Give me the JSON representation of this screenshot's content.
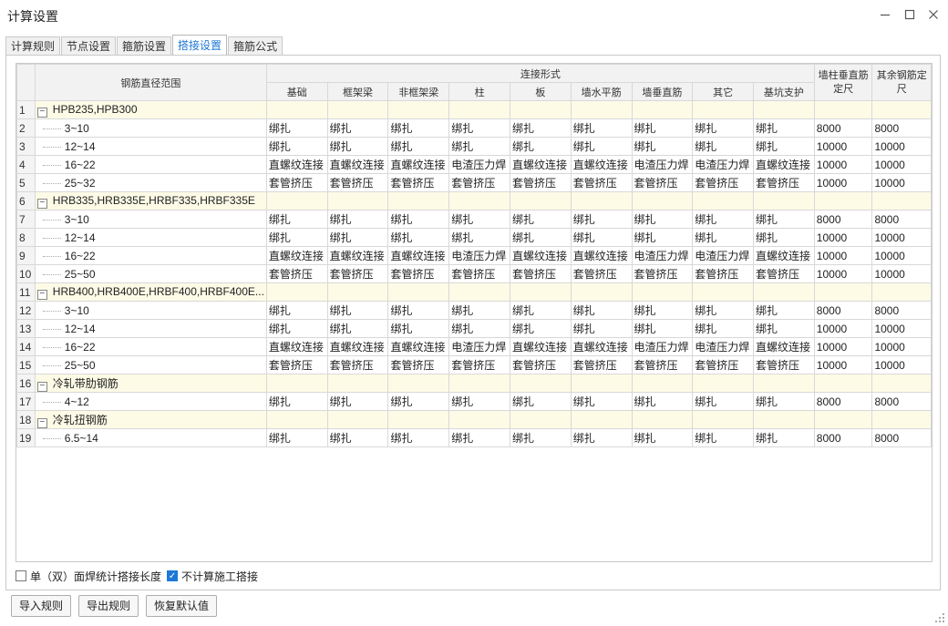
{
  "window": {
    "title": "计算设置"
  },
  "tabs": [
    {
      "label": "计算规则",
      "active": false
    },
    {
      "label": "节点设置",
      "active": false
    },
    {
      "label": "箍筋设置",
      "active": false
    },
    {
      "label": "搭接设置",
      "active": true
    },
    {
      "label": "箍筋公式",
      "active": false
    }
  ],
  "table": {
    "header": {
      "range": "钢筋直径范围",
      "connection_group": "连接形式",
      "connection_cols": [
        "基础",
        "框架梁",
        "非框架梁",
        "柱",
        "板",
        "墙水平筋",
        "墙垂直筋",
        "其它",
        "基坑支护"
      ],
      "wall_len": "墙柱垂直筋定尺",
      "other_len": "其余钢筋定尺"
    },
    "rows": [
      {
        "n": "1",
        "group": true,
        "name": "HPB235,HPB300"
      },
      {
        "n": "2",
        "name": "3~10",
        "cells": [
          "绑扎",
          "绑扎",
          "绑扎",
          "绑扎",
          "绑扎",
          "绑扎",
          "绑扎",
          "绑扎",
          "绑扎"
        ],
        "wall": "8000",
        "other": "8000"
      },
      {
        "n": "3",
        "name": "12~14",
        "cells": [
          "绑扎",
          "绑扎",
          "绑扎",
          "绑扎",
          "绑扎",
          "绑扎",
          "绑扎",
          "绑扎",
          "绑扎"
        ],
        "wall": "10000",
        "other": "10000"
      },
      {
        "n": "4",
        "name": "16~22",
        "cells": [
          "直螺纹连接",
          "直螺纹连接",
          "直螺纹连接",
          "电渣压力焊",
          "直螺纹连接",
          "直螺纹连接",
          "电渣压力焊",
          "电渣压力焊",
          "直螺纹连接"
        ],
        "wall": "10000",
        "other": "10000"
      },
      {
        "n": "5",
        "name": "25~32",
        "cells": [
          "套管挤压",
          "套管挤压",
          "套管挤压",
          "套管挤压",
          "套管挤压",
          "套管挤压",
          "套管挤压",
          "套管挤压",
          "套管挤压"
        ],
        "wall": "10000",
        "other": "10000"
      },
      {
        "n": "6",
        "group": true,
        "name": "HRB335,HRB335E,HRBF335,HRBF335E"
      },
      {
        "n": "7",
        "name": "3~10",
        "cells": [
          "绑扎",
          "绑扎",
          "绑扎",
          "绑扎",
          "绑扎",
          "绑扎",
          "绑扎",
          "绑扎",
          "绑扎"
        ],
        "wall": "8000",
        "other": "8000"
      },
      {
        "n": "8",
        "name": "12~14",
        "cells": [
          "绑扎",
          "绑扎",
          "绑扎",
          "绑扎",
          "绑扎",
          "绑扎",
          "绑扎",
          "绑扎",
          "绑扎"
        ],
        "wall": "10000",
        "other": "10000"
      },
      {
        "n": "9",
        "name": "16~22",
        "cells": [
          "直螺纹连接",
          "直螺纹连接",
          "直螺纹连接",
          "电渣压力焊",
          "直螺纹连接",
          "直螺纹连接",
          "电渣压力焊",
          "电渣压力焊",
          "直螺纹连接"
        ],
        "wall": "10000",
        "other": "10000"
      },
      {
        "n": "10",
        "name": "25~50",
        "cells": [
          "套管挤压",
          "套管挤压",
          "套管挤压",
          "套管挤压",
          "套管挤压",
          "套管挤压",
          "套管挤压",
          "套管挤压",
          "套管挤压"
        ],
        "wall": "10000",
        "other": "10000"
      },
      {
        "n": "11",
        "group": true,
        "name": "HRB400,HRB400E,HRBF400,HRBF400E..."
      },
      {
        "n": "12",
        "name": "3~10",
        "cells": [
          "绑扎",
          "绑扎",
          "绑扎",
          "绑扎",
          "绑扎",
          "绑扎",
          "绑扎",
          "绑扎",
          "绑扎"
        ],
        "wall": "8000",
        "other": "8000"
      },
      {
        "n": "13",
        "name": "12~14",
        "cells": [
          "绑扎",
          "绑扎",
          "绑扎",
          "绑扎",
          "绑扎",
          "绑扎",
          "绑扎",
          "绑扎",
          "绑扎"
        ],
        "wall": "10000",
        "other": "10000"
      },
      {
        "n": "14",
        "name": "16~22",
        "cells": [
          "直螺纹连接",
          "直螺纹连接",
          "直螺纹连接",
          "电渣压力焊",
          "直螺纹连接",
          "直螺纹连接",
          "电渣压力焊",
          "电渣压力焊",
          "直螺纹连接"
        ],
        "wall": "10000",
        "other": "10000"
      },
      {
        "n": "15",
        "name": "25~50",
        "cells": [
          "套管挤压",
          "套管挤压",
          "套管挤压",
          "套管挤压",
          "套管挤压",
          "套管挤压",
          "套管挤压",
          "套管挤压",
          "套管挤压"
        ],
        "wall": "10000",
        "other": "10000"
      },
      {
        "n": "16",
        "group": true,
        "name": "冷轧带肋钢筋"
      },
      {
        "n": "17",
        "name": "4~12",
        "cells": [
          "绑扎",
          "绑扎",
          "绑扎",
          "绑扎",
          "绑扎",
          "绑扎",
          "绑扎",
          "绑扎",
          "绑扎"
        ],
        "wall": "8000",
        "other": "8000"
      },
      {
        "n": "18",
        "group": true,
        "name": "冷轧扭钢筋"
      },
      {
        "n": "19",
        "name": "6.5~14",
        "cells": [
          "绑扎",
          "绑扎",
          "绑扎",
          "绑扎",
          "绑扎",
          "绑扎",
          "绑扎",
          "绑扎",
          "绑扎"
        ],
        "wall": "8000",
        "other": "8000"
      }
    ]
  },
  "options": [
    {
      "label": "单（双）面焊统计搭接长度",
      "checked": false
    },
    {
      "label": "不计算施工搭接",
      "checked": true
    }
  ],
  "buttons": {
    "import": "导入规则",
    "export": "导出规则",
    "restore": "恢复默认值"
  },
  "icons": {
    "minimize": "minimize-icon",
    "maximize": "maximize-icon",
    "close": "close-icon",
    "collapse": "collapse-minus-icon"
  },
  "colors": {
    "accent": "#1e78d6",
    "group_row": "#fdfbe6"
  }
}
